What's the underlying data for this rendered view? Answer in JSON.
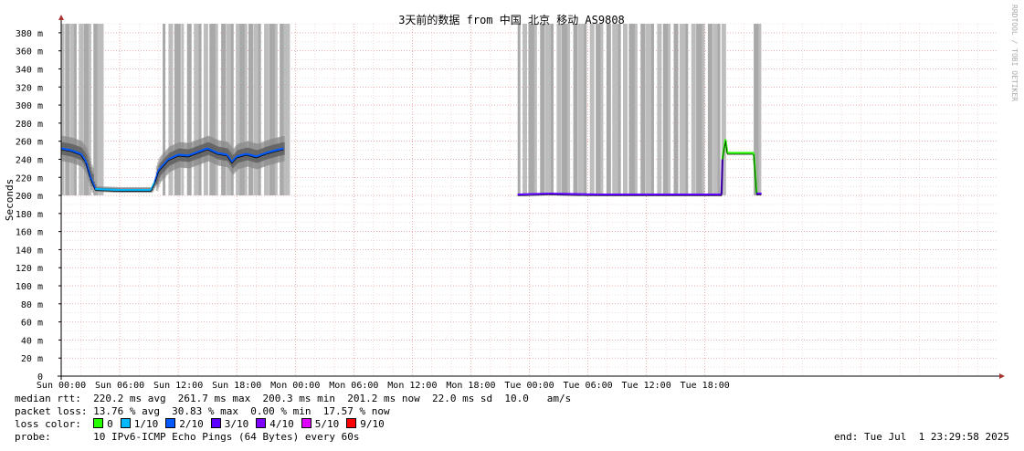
{
  "chart_data": {
    "type": "line",
    "title": "3天前的数据 from 中国 北京 移动 AS9808",
    "ylabel": "Seconds",
    "watermark": "RRDTOOL / TOBI OETIKER",
    "ylim": [
      0,
      390
    ],
    "yticks": [
      {
        "v": 0,
        "label": "0"
      },
      {
        "v": 20,
        "label": "20 m"
      },
      {
        "v": 40,
        "label": "40 m"
      },
      {
        "v": 60,
        "label": "60 m"
      },
      {
        "v": 80,
        "label": "80 m"
      },
      {
        "v": 100,
        "label": "100 m"
      },
      {
        "v": 120,
        "label": "120 m"
      },
      {
        "v": 140,
        "label": "140 m"
      },
      {
        "v": 160,
        "label": "160 m"
      },
      {
        "v": 180,
        "label": "180 m"
      },
      {
        "v": 200,
        "label": "200 m"
      },
      {
        "v": 220,
        "label": "220 m"
      },
      {
        "v": 240,
        "label": "240 m"
      },
      {
        "v": 260,
        "label": "260 m"
      },
      {
        "v": 280,
        "label": "280 m"
      },
      {
        "v": 300,
        "label": "300 m"
      },
      {
        "v": 320,
        "label": "320 m"
      },
      {
        "v": 340,
        "label": "340 m"
      },
      {
        "v": 360,
        "label": "360 m"
      },
      {
        "v": 380,
        "label": "380 m"
      }
    ],
    "xlim": [
      0,
      96
    ],
    "xticks": [
      {
        "h": 0,
        "label": "Sun 00:00"
      },
      {
        "h": 6,
        "label": "Sun 06:00"
      },
      {
        "h": 12,
        "label": "Sun 12:00"
      },
      {
        "h": 18,
        "label": "Sun 18:00"
      },
      {
        "h": 24,
        "label": "Mon 00:00"
      },
      {
        "h": 30,
        "label": "Mon 06:00"
      },
      {
        "h": 36,
        "label": "Mon 12:00"
      },
      {
        "h": 42,
        "label": "Mon 18:00"
      },
      {
        "h": 48,
        "label": "Tue 00:00"
      },
      {
        "h": 54,
        "label": "Tue 06:00"
      },
      {
        "h": 60,
        "label": "Tue 12:00"
      },
      {
        "h": 66,
        "label": "Tue 18:00"
      }
    ],
    "median_rtt": [
      {
        "h": 0.0,
        "ms": 252
      },
      {
        "h": 1.0,
        "ms": 250
      },
      {
        "h": 2.0,
        "ms": 246
      },
      {
        "h": 2.5,
        "ms": 238
      },
      {
        "h": 3.0,
        "ms": 220
      },
      {
        "h": 3.5,
        "ms": 207
      },
      {
        "h": 6.0,
        "ms": 206
      },
      {
        "h": 9.2,
        "ms": 206
      },
      {
        "h": 9.6,
        "ms": 215
      },
      {
        "h": 10.0,
        "ms": 228
      },
      {
        "h": 11.0,
        "ms": 240
      },
      {
        "h": 12.0,
        "ms": 245
      },
      {
        "h": 13.0,
        "ms": 244
      },
      {
        "h": 14.0,
        "ms": 248
      },
      {
        "h": 15.0,
        "ms": 252
      },
      {
        "h": 16.0,
        "ms": 247
      },
      {
        "h": 17.0,
        "ms": 245
      },
      {
        "h": 17.5,
        "ms": 237
      },
      {
        "h": 18.0,
        "ms": 243
      },
      {
        "h": 19.0,
        "ms": 246
      },
      {
        "h": 20.0,
        "ms": 243
      },
      {
        "h": 21.0,
        "ms": 247
      },
      {
        "h": 22.0,
        "ms": 250
      },
      {
        "h": 22.8,
        "ms": 252
      },
      {
        "h": null,
        "ms": null
      },
      {
        "h": 46.8,
        "ms": 201
      },
      {
        "h": 50.0,
        "ms": 202
      },
      {
        "h": 55.0,
        "ms": 201
      },
      {
        "h": 60.0,
        "ms": 201
      },
      {
        "h": 65.0,
        "ms": 201
      },
      {
        "h": 67.7,
        "ms": 201
      },
      {
        "h": 67.8,
        "ms": 240
      },
      {
        "h": 68.1,
        "ms": 262
      },
      {
        "h": 68.3,
        "ms": 247
      },
      {
        "h": 71.0,
        "ms": 247
      },
      {
        "h": 71.3,
        "ms": 202
      },
      {
        "h": 71.8,
        "ms": 202
      }
    ],
    "loss_spikes_h": [
      0.05,
      0.4,
      0.9,
      1.3,
      1.8,
      2.3,
      2.8,
      3.3,
      3.7,
      10.4,
      11.0,
      11.6,
      12.3,
      12.9,
      13.6,
      14.1,
      14.6,
      15.2,
      15.8,
      16.4,
      16.9,
      17.4,
      17.9,
      18.3,
      18.8,
      19.2,
      19.7,
      20.2,
      20.8,
      21.3,
      21.9,
      22.4,
      22.8,
      46.8,
      47.3,
      47.9,
      48.5,
      49.1,
      49.6,
      50.2,
      50.8,
      51.3,
      51.9,
      52.5,
      53.0,
      53.6,
      54.2,
      54.8,
      55.3,
      55.9,
      56.5,
      57.1,
      57.6,
      58.2,
      58.8,
      59.4,
      59.9,
      60.5,
      61.1,
      61.7,
      62.2,
      62.8,
      63.4,
      64.0,
      64.6,
      65.1,
      65.7,
      66.3,
      66.8,
      67.3,
      67.7,
      71.0,
      71.5
    ],
    "loss_colors": [
      {
        "label": "0",
        "color": "#26ff00"
      },
      {
        "label": "1/10",
        "color": "#00b8ff"
      },
      {
        "label": "2/10",
        "color": "#0059ff"
      },
      {
        "label": "3/10",
        "color": "#5e00ff"
      },
      {
        "label": "4/10",
        "color": "#7e00ff"
      },
      {
        "label": "5/10",
        "color": "#dd00ff"
      },
      {
        "label": "9/10",
        "color": "#ff0000"
      }
    ]
  },
  "legend": {
    "median_rtt": "median rtt:  220.2 ms avg  261.7 ms max  200.3 ms min  201.2 ms now  22.0 ms sd  10.0   am/s",
    "packet_loss": "packet loss: 13.76 % avg  30.83 % max  0.00 % min  17.57 % now",
    "loss_color_label": "loss color:",
    "probe": "probe:       10 IPv6-ICMP Echo Pings (64 Bytes) every 60s",
    "end": "end: Tue Jul  1 23:29:58 2025"
  }
}
